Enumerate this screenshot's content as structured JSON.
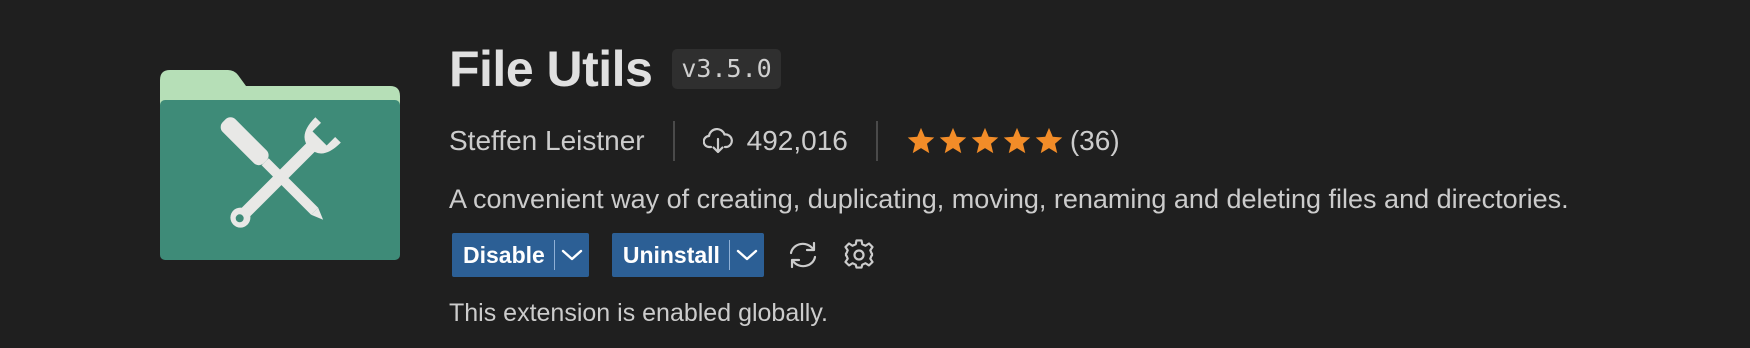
{
  "extension": {
    "name": "File Utils",
    "version": "v3.5.0",
    "publisher": "Steffen Leistner",
    "installs": "492,016",
    "rating_count": "(36)",
    "stars": 5,
    "description": "A convenient way of creating, duplicating, moving, renaming and deleting files and directories.",
    "status": "This extension is enabled globally."
  },
  "actions": {
    "disable_label": "Disable",
    "uninstall_label": "Uninstall"
  },
  "icons": {
    "logo": "folder-tools-icon",
    "installs": "cloud-download-icon",
    "star": "star-icon",
    "dropdown": "chevron-down-icon",
    "sync": "sync-icon",
    "settings": "gear-icon"
  },
  "colors": {
    "background": "#1f1f1f",
    "folder_body": "#3e8b78",
    "folder_tab": "#b6dfb7",
    "star": "#f28c28",
    "button": "#2c5f95"
  }
}
